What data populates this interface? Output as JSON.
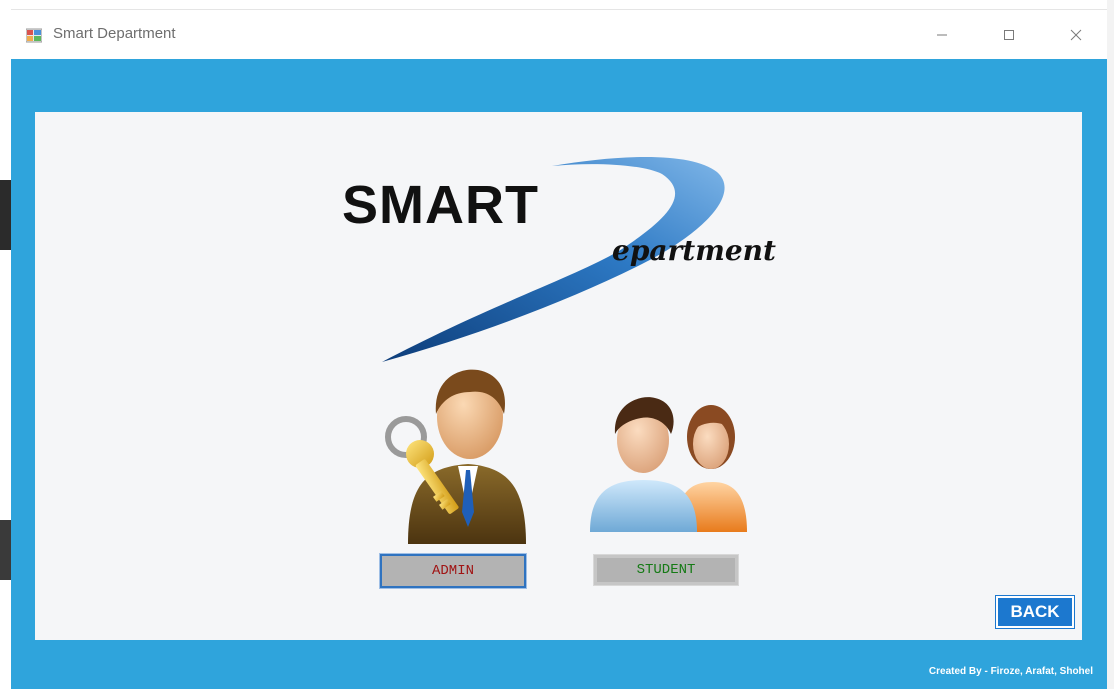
{
  "window": {
    "title": "Smart Department",
    "controls": [
      "minimize",
      "maximize",
      "close"
    ]
  },
  "logo": {
    "main": "SMART",
    "secondary": "epartment"
  },
  "buttons": {
    "admin": "ADMIN",
    "student": "STUDENT",
    "back": "BACK"
  },
  "footer": {
    "credit": "Created By - Firoze, Arafat, Shohel"
  },
  "colors": {
    "window_bg": "#2fa4dc",
    "panel_bg": "#f5f6f8",
    "back_button": "#1c78cf",
    "admin_text": "#a01313",
    "student_text": "#157a15"
  },
  "icons": {
    "admin": "admin-key-icon",
    "student": "students-icon",
    "app": "app-icon"
  }
}
